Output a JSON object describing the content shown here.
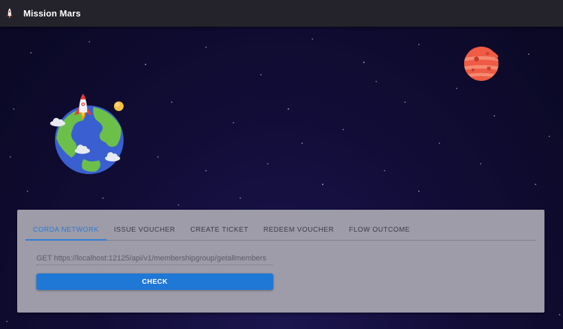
{
  "appbar": {
    "title": "Mission Mars",
    "icon": "rocket-icon"
  },
  "scene": {
    "earth_icon": "earth-icon",
    "mars_icon": "mars-icon",
    "rocket_icon": "rocket-icon",
    "sun_icon": "sun-icon",
    "cloud_icon": "cloud-icon"
  },
  "panel": {
    "tabs": [
      {
        "label": "CORDA NETWORK",
        "active": true
      },
      {
        "label": "ISSUE VOUCHER",
        "active": false
      },
      {
        "label": "CREATE TICKET",
        "active": false
      },
      {
        "label": "REDEEM VOUCHER",
        "active": false
      },
      {
        "label": "FLOW OUTCOME",
        "active": false
      }
    ],
    "endpoint": "GET https://localhost:12125/api/v1/membershipgroup/getallmembers",
    "check_label": "CHECK"
  },
  "colors": {
    "accent": "#2a7bd8",
    "button": "#1f77d6",
    "panel": "#9d9ca8",
    "appbar": "#24232b",
    "background": "#120d38"
  }
}
